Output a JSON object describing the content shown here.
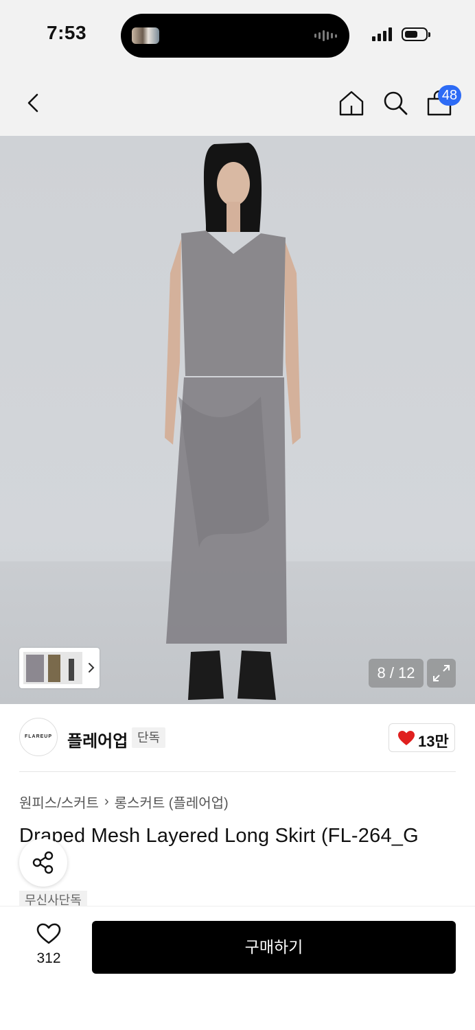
{
  "status_bar": {
    "time": "7:53"
  },
  "nav": {
    "cart_count": "48"
  },
  "gallery": {
    "current": "8 / 12"
  },
  "brand": {
    "logo_text": "FLAREUP",
    "name": "플레어업",
    "tag": "단독",
    "likes": "13만"
  },
  "breadcrumb": {
    "category": "원피스/스커트",
    "separator": "›",
    "subcategory": "롱스커트 (플레어업)"
  },
  "product": {
    "title": "Draped Mesh Layered Long Skirt (FL-264_G",
    "tag": "무신사단독"
  },
  "bottom_bar": {
    "wish_count": "312",
    "buy_label": "구매하기"
  },
  "colors": {
    "accent_badge": "#2d6bf5",
    "heart": "#e0201f",
    "buy_button": "#000000"
  },
  "icons": [
    "back-icon",
    "home-icon",
    "search-icon",
    "cart-icon",
    "expand-icon",
    "chevron-right-icon",
    "heart-icon",
    "share-icon",
    "heart-outline-icon"
  ]
}
